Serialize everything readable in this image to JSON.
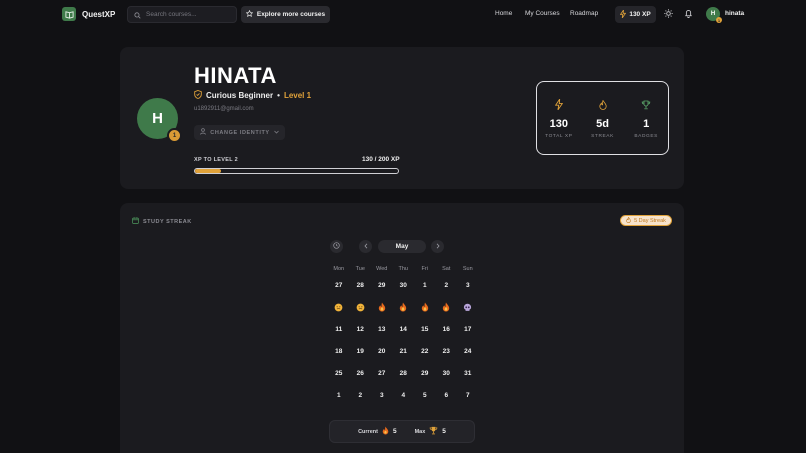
{
  "app": {
    "name": "QuestXP"
  },
  "nav": {
    "search_placeholder": "Search courses...",
    "explore_label": "Explore more courses",
    "links": [
      "Home",
      "My Courses",
      "Roadmap"
    ],
    "xp": "130 XP",
    "avatar_initial": "H",
    "avatar_badge": "1",
    "username": "hinata"
  },
  "profile": {
    "avatar_initial": "H",
    "level_badge": "1",
    "name": "HINATA",
    "rank": "Curious Beginner",
    "separator": "•",
    "level": "Level 1",
    "email": "u1892911@gmail.com",
    "change_identity": "CHANGE IDENTITY",
    "xp_label": "XP TO LEVEL 2",
    "xp_value": "130 / 200 XP",
    "xp_progress": 0.13,
    "stats": [
      {
        "icon": "lightning-icon",
        "value": "130",
        "label": "TOTAL XP"
      },
      {
        "icon": "flame-icon",
        "value": "5d",
        "label": "STREAK"
      },
      {
        "icon": "trophy-icon",
        "value": "1",
        "label": "BADGES"
      }
    ]
  },
  "streak": {
    "title": "STUDY STREAK",
    "pill": "5 Day Streak",
    "month": "May",
    "weekdays": [
      "Mon",
      "Tue",
      "Wed",
      "Thu",
      "Fri",
      "Sat",
      "Sun"
    ],
    "weeks": [
      [
        "27",
        "28",
        "29",
        "30",
        "1",
        "2",
        "3"
      ],
      [
        "face",
        "face",
        "fire",
        "fire",
        "fire",
        "fire",
        "skull"
      ],
      [
        "11",
        "12",
        "13",
        "14",
        "15",
        "16",
        "17"
      ],
      [
        "18",
        "19",
        "20",
        "21",
        "22",
        "23",
        "24"
      ],
      [
        "25",
        "26",
        "27",
        "28",
        "29",
        "30",
        "31"
      ],
      [
        "1",
        "2",
        "3",
        "4",
        "5",
        "6",
        "7"
      ]
    ],
    "current_label": "Current",
    "current_value": "5",
    "max_label": "Max",
    "max_value": "5"
  },
  "colors": {
    "accent": "#e0a23a",
    "brand": "#3f7a4a",
    "background": "#111114",
    "card": "#1b1b1f"
  }
}
